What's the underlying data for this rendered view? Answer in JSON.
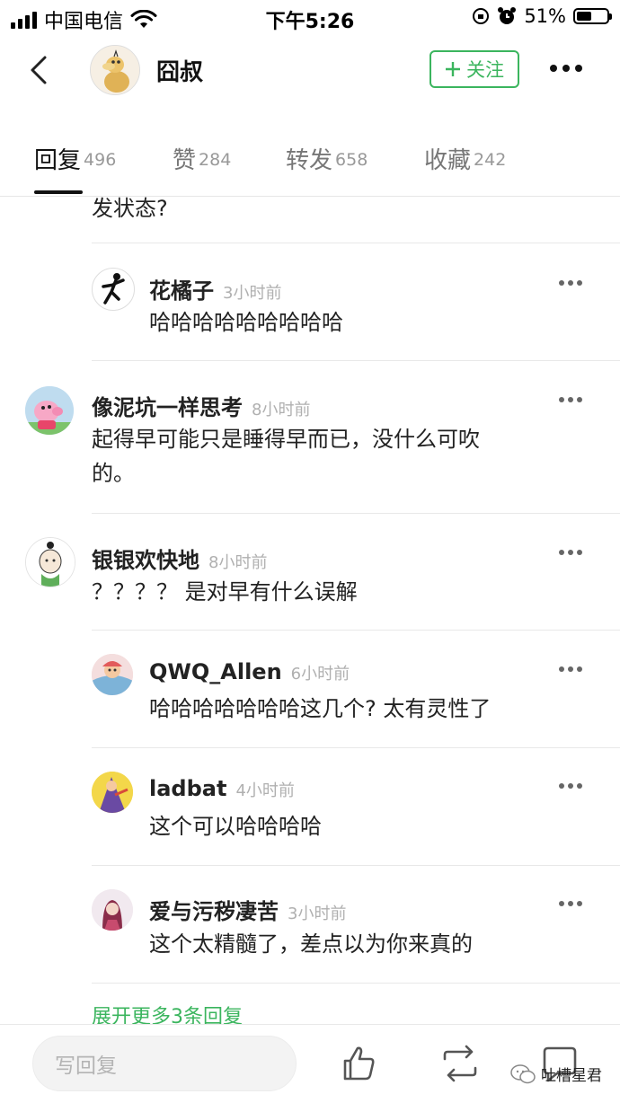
{
  "status": {
    "carrier": "中国电信",
    "time": "下午5:26",
    "battery": "51%",
    "battery_level": 0.51
  },
  "header": {
    "title": "囧叔",
    "follow_label": "关注"
  },
  "tabs": [
    {
      "label": "回复",
      "count": "496",
      "active": true
    },
    {
      "label": "赞",
      "count": "284"
    },
    {
      "label": "转发",
      "count": "658"
    },
    {
      "label": "收藏",
      "count": "242"
    }
  ],
  "fragment_text": "发状态?",
  "comments": [
    {
      "name": "花橘子",
      "time": "3小时前",
      "text": "哈哈哈哈哈哈哈哈哈"
    },
    {
      "name": "像泥坑一样思考",
      "time": "8小时前",
      "text_line1": "起得早可能只是睡得早而已，没什么可吹",
      "text_line2": "的。"
    },
    {
      "name": "银银欢快地",
      "time": "8小时前",
      "text": "？？？？ 是对早有什么误解"
    },
    {
      "name": "QWQ_Allen",
      "time": "6小时前",
      "text": "哈哈哈哈哈哈哈这几个? 太有灵性了"
    },
    {
      "name": "ladbat",
      "time": "4小时前",
      "text": "这个可以哈哈哈哈"
    },
    {
      "name": "爱与污秽凄苦",
      "time": "3小时前",
      "text": "这个太精髓了，差点以为你来真的"
    }
  ],
  "expand_label": "展开更多3条回复",
  "bottom": {
    "reply_placeholder": "写回复",
    "watermark": "吐槽星君"
  }
}
